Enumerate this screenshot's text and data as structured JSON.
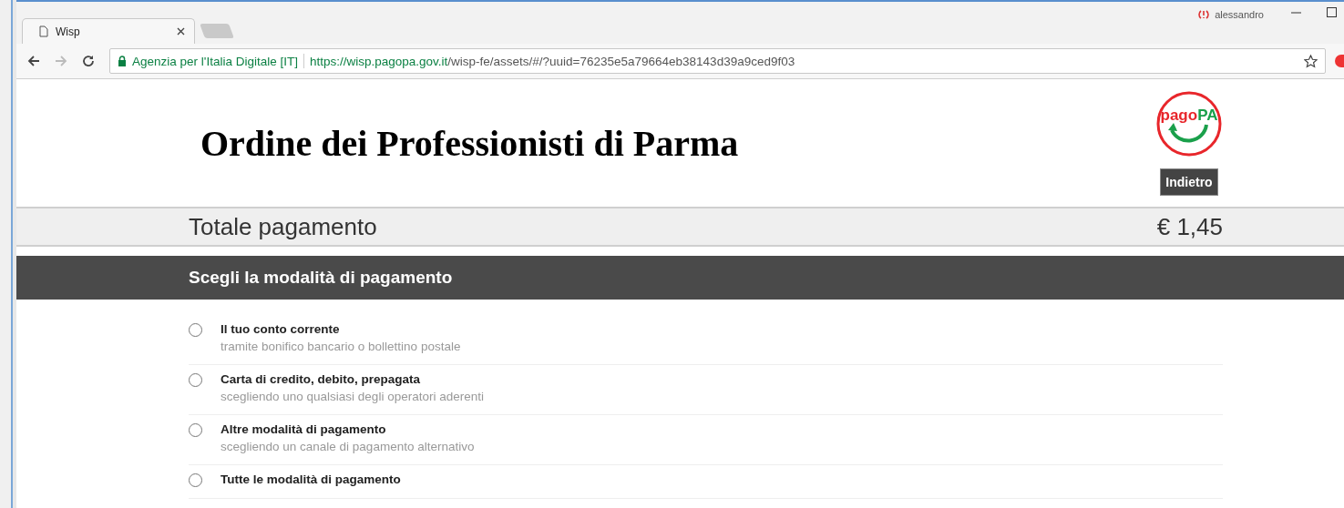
{
  "browser": {
    "tab_title": "Wisp",
    "user": "alessandro",
    "site_identity": "Agenzia per l'Italia Digitale [IT]",
    "url_host": "https://wisp.pagopa.gov.it",
    "url_path": "/wisp-fe/assets/#/?uuid=76235e5a79664eb38143d39a9ced9f03"
  },
  "header": {
    "title": "Ordine dei Professionisti di Parma",
    "logo": {
      "part_1": "pago",
      "part_2": "PA"
    },
    "back_button": "Indietro"
  },
  "total": {
    "label": "Totale pagamento",
    "amount": "€ 1,45"
  },
  "section_title": "Scegli la modalità di pagamento",
  "options": [
    {
      "title": "Il tuo conto corrente",
      "subtitle": "tramite bonifico bancario o bollettino postale",
      "selected": false
    },
    {
      "title": "Carta di credito, debito, prepagata",
      "subtitle": "scegliendo uno qualsiasi degli operatori aderenti",
      "selected": false
    },
    {
      "title": "Altre modalità di pagamento",
      "subtitle": "scegliendo un canale di pagamento alternativo",
      "selected": false
    },
    {
      "title": "Tutte le modalità di pagamento",
      "selected": false
    }
  ]
}
